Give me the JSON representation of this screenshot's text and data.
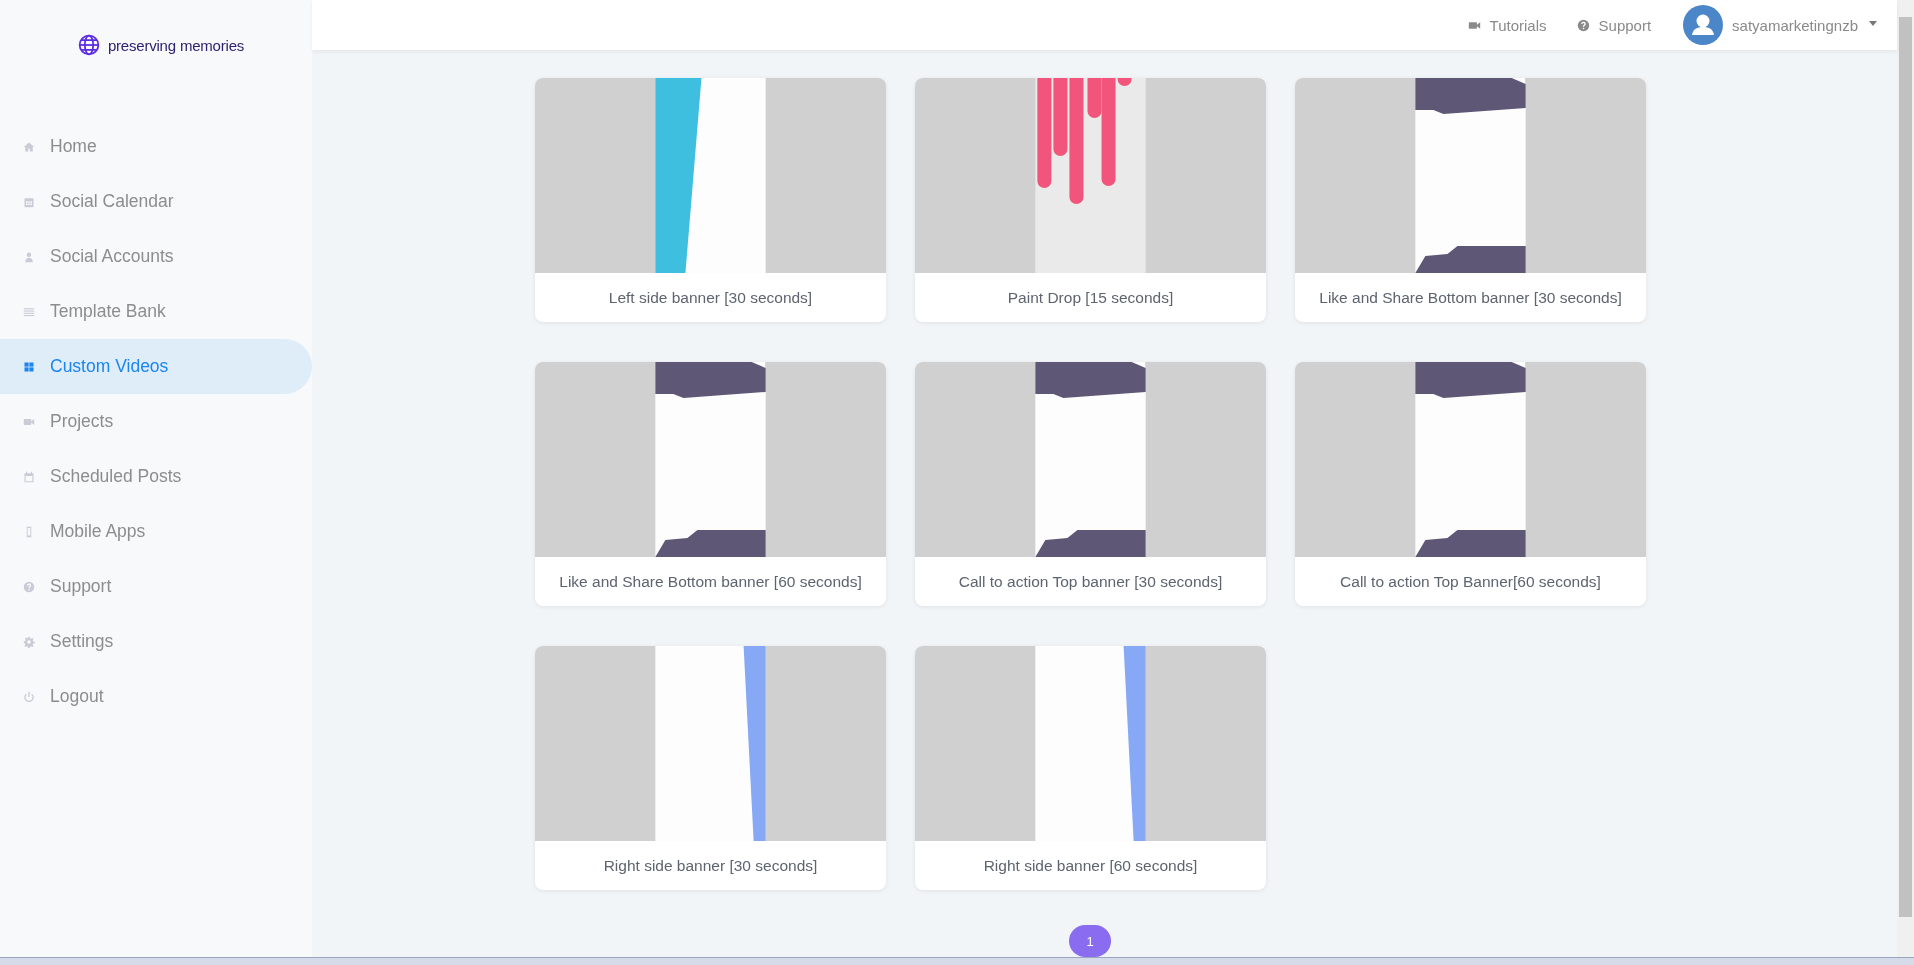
{
  "brand": {
    "name": "preserving memories"
  },
  "sidebar": {
    "items": [
      {
        "label": "Home",
        "selected": false
      },
      {
        "label": "Social Calendar",
        "selected": false
      },
      {
        "label": "Social Accounts",
        "selected": false
      },
      {
        "label": "Template Bank",
        "selected": false
      },
      {
        "label": "Custom Videos",
        "selected": true
      },
      {
        "label": "Projects",
        "selected": false
      },
      {
        "label": "Scheduled Posts",
        "selected": false
      },
      {
        "label": "Mobile Apps",
        "selected": false
      },
      {
        "label": "Support",
        "selected": false
      },
      {
        "label": "Settings",
        "selected": false
      },
      {
        "label": "Logout",
        "selected": false
      }
    ]
  },
  "topbar": {
    "links": [
      {
        "label": "Tutorials"
      },
      {
        "label": "Support"
      }
    ],
    "user": {
      "name": "satyamarketingnzb"
    }
  },
  "templates": [
    {
      "title": "Left side banner [30 seconds]"
    },
    {
      "title": "Paint Drop [15 seconds]"
    },
    {
      "title": "Like and Share Bottom banner [30 seconds]"
    },
    {
      "title": "Like and Share Bottom banner [60 seconds]"
    },
    {
      "title": "Call to action Top banner [30 seconds]"
    },
    {
      "title": "Call to action Top Banner[60 seconds]"
    },
    {
      "title": "Right side banner [30 seconds]"
    },
    {
      "title": "Right side banner [60 seconds]"
    }
  ],
  "pagination": [
    {
      "label": "1",
      "selected": true
    }
  ]
}
